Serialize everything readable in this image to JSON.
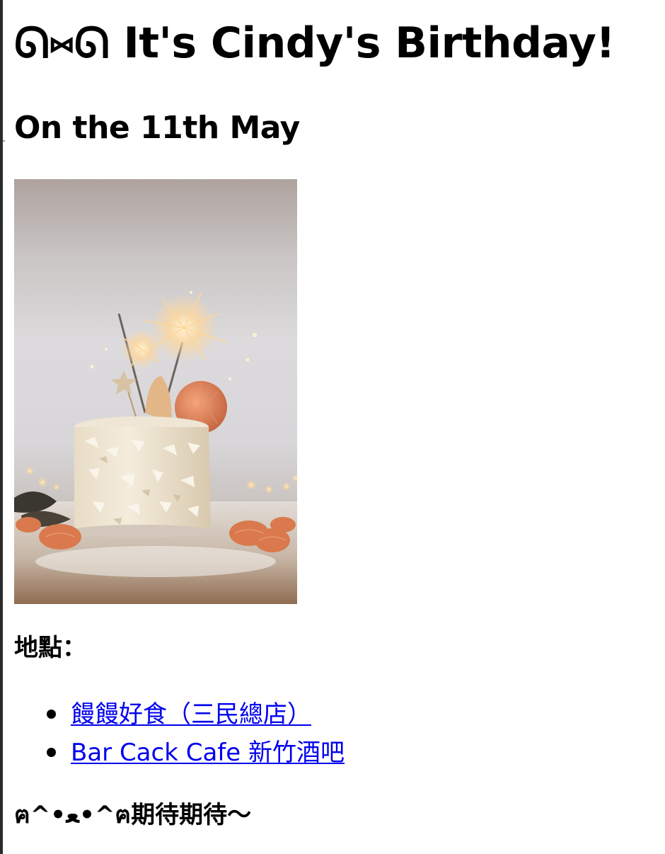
{
  "page": {
    "title": "ᘏ⑅ᘏ It's Cindy's Birthday!",
    "subtitle": "On the 11th May",
    "photo_icon": "birthday-cake-photo",
    "location_label": "地點：",
    "locations": [
      {
        "label": "饅饅好食（三民總店）"
      },
      {
        "label": "Bar Cack Cafe 新竹酒吧"
      }
    ],
    "footer": "ฅ^•ﻌ•^ฅ期待期待～"
  },
  "colors": {
    "link": "#0000ee",
    "text": "#000000",
    "left_border": "#2b2b2b"
  }
}
